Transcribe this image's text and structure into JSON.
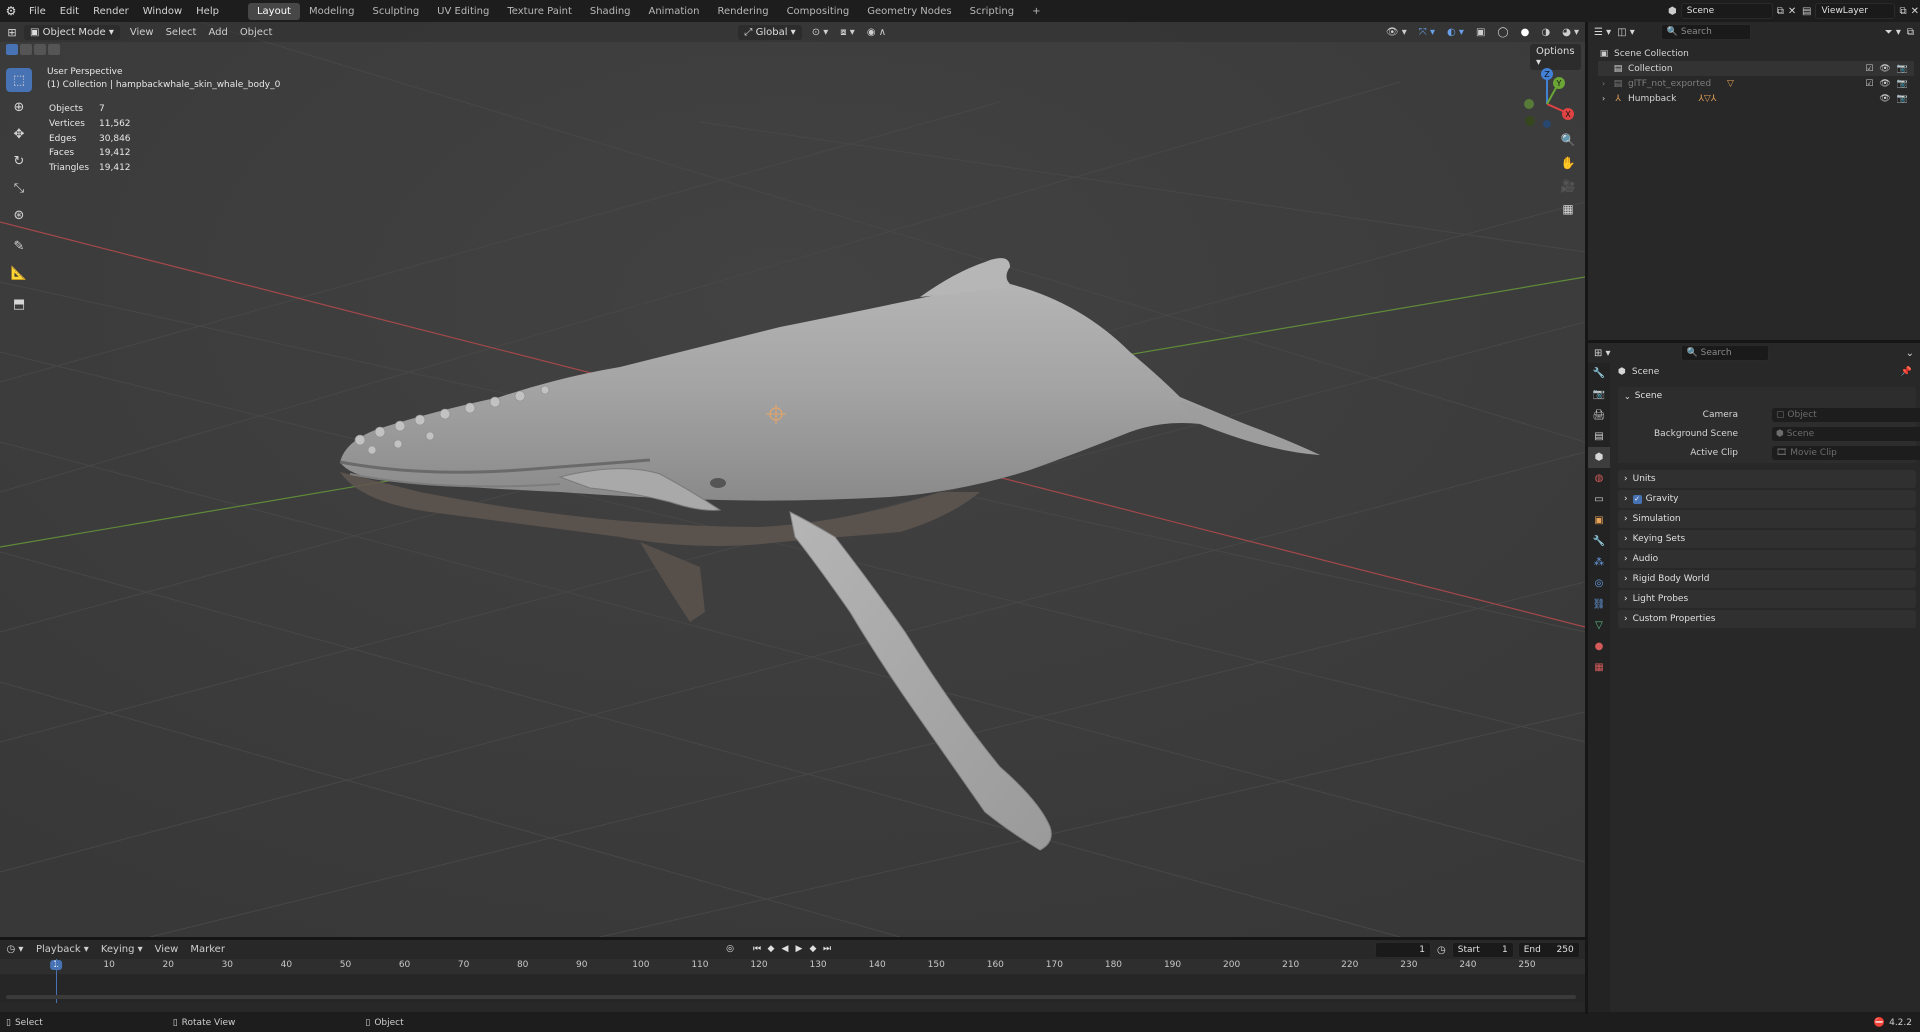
{
  "topbar": {
    "menus": [
      "File",
      "Edit",
      "Render",
      "Window",
      "Help"
    ],
    "workspaces": [
      "Layout",
      "Modeling",
      "Sculpting",
      "UV Editing",
      "Texture Paint",
      "Shading",
      "Animation",
      "Rendering",
      "Compositing",
      "Geometry Nodes",
      "Scripting"
    ],
    "active_workspace": "Layout",
    "add_tab": "+",
    "scene_name": "Scene",
    "view_layer": "ViewLayer"
  },
  "viewport": {
    "mode": "Object Mode",
    "menus": [
      "View",
      "Select",
      "Add",
      "Object"
    ],
    "orientation": "Global",
    "options_label": "Options",
    "perspective": "User Perspective",
    "active_path": "(1) Collection | hampbackwhale_skin_whale_body_0",
    "stats": [
      {
        "label": "Objects",
        "value": "7"
      },
      {
        "label": "Vertices",
        "value": "11,562"
      },
      {
        "label": "Edges",
        "value": "30,846"
      },
      {
        "label": "Faces",
        "value": "19,412"
      },
      {
        "label": "Triangles",
        "value": "19,412"
      }
    ],
    "gizmo_axes": {
      "z": "Z",
      "y": "Y",
      "x": "X"
    },
    "axis_colors": {
      "x": "#e04343",
      "y": "#6aa536",
      "z": "#4281d6"
    }
  },
  "outliner": {
    "search_placeholder": "Search",
    "scene_collection": "Scene Collection",
    "items": [
      {
        "label": "Collection",
        "indent": 1
      },
      {
        "label": "glTF_not_exported",
        "indent": 1
      },
      {
        "label": "Humpback",
        "indent": 1
      }
    ]
  },
  "properties": {
    "search_placeholder": "Search",
    "context": "Scene",
    "section": "Scene",
    "fields": [
      {
        "label": "Camera",
        "placeholder": "Object"
      },
      {
        "label": "Background Scene",
        "placeholder": "Scene"
      },
      {
        "label": "Active Clip",
        "placeholder": "Movie Clip"
      }
    ],
    "panels": [
      "Units",
      "Gravity",
      "Simulation",
      "Keying Sets",
      "Audio",
      "Rigid Body World",
      "Light Probes",
      "Custom Properties"
    ]
  },
  "timeline": {
    "menus": [
      "Playback",
      "Keying",
      "View",
      "Marker"
    ],
    "current_frame": "1",
    "start_label": "Start",
    "start_value": "1",
    "end_label": "End",
    "end_value": "250",
    "ticks": [
      "1",
      "10",
      "20",
      "30",
      "40",
      "50",
      "60",
      "70",
      "80",
      "90",
      "100",
      "110",
      "120",
      "130",
      "140",
      "150",
      "160",
      "170",
      "180",
      "190",
      "200",
      "210",
      "220",
      "230",
      "240",
      "250"
    ]
  },
  "statusbar": {
    "select": "Select",
    "rotate": "Rotate View",
    "object": "Object",
    "version": "4.2.2"
  },
  "colors": {
    "accent": "#4772b3",
    "viewport_bg": "#3d3d3d"
  }
}
